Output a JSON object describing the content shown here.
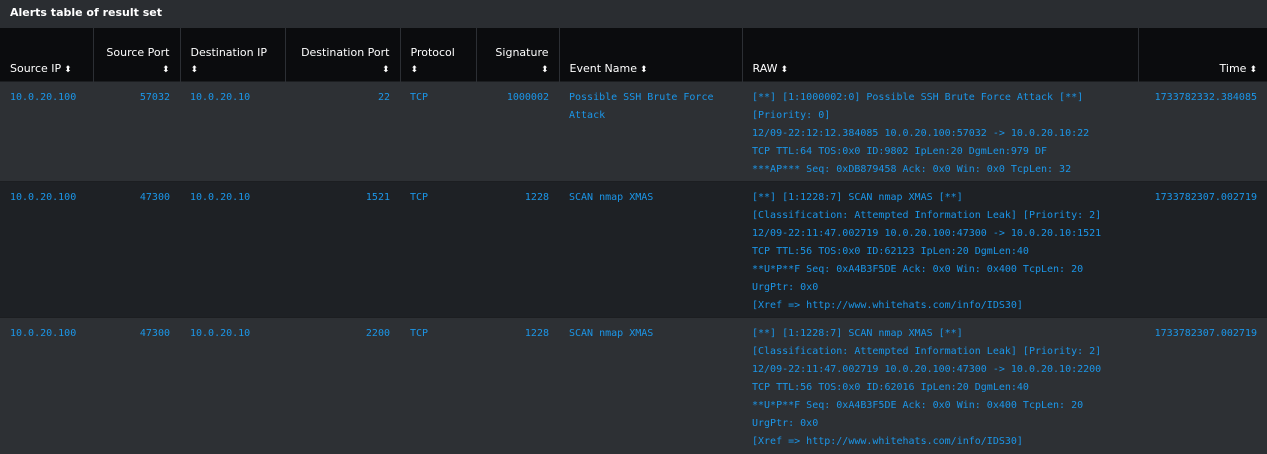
{
  "panel": {
    "title": "Alerts table of result set"
  },
  "colors": {
    "link": "#1b96e8",
    "header_bg": "#0b0c0e",
    "row_odd": "#2d3034",
    "row_even": "#1e2125"
  },
  "columns": [
    {
      "label": "Source IP",
      "sort_icon": "sort-icon"
    },
    {
      "label": "Source Port",
      "sort_icon": "sort-icon"
    },
    {
      "label": "Destination IP",
      "sort_icon": "sort-icon"
    },
    {
      "label": "Destination Port",
      "sort_icon": "sort-icon"
    },
    {
      "label": "Protocol",
      "sort_icon": "sort-icon"
    },
    {
      "label": "Signature",
      "sort_icon": "sort-icon"
    },
    {
      "label": "Event Name",
      "sort_icon": "sort-icon"
    },
    {
      "label": "RAW",
      "sort_icon": "sort-icon"
    },
    {
      "label": "Time",
      "sort_icon": "sort-icon"
    }
  ],
  "rows": [
    {
      "source_ip": "10.0.20.100",
      "source_port": "57032",
      "destination_ip": "10.0.20.10",
      "destination_port": "22",
      "protocol": "TCP",
      "signature": "1000002",
      "event_name": "Possible SSH Brute Force Attack",
      "raw": [
        "[**] [1:1000002:0] Possible SSH Brute Force Attack [**]",
        "[Priority: 0]",
        "12/09-22:12:12.384085 10.0.20.100:57032 -> 10.0.20.10:22",
        "TCP TTL:64 TOS:0x0 ID:9802 IpLen:20 DgmLen:979 DF",
        "***AP*** Seq: 0xDB879458  Ack: 0x0  Win: 0x0  TcpLen: 32"
      ],
      "time": "1733782332.384085"
    },
    {
      "source_ip": "10.0.20.100",
      "source_port": "47300",
      "destination_ip": "10.0.20.10",
      "destination_port": "1521",
      "protocol": "TCP",
      "signature": "1228",
      "event_name": "SCAN nmap XMAS",
      "raw": [
        "[**] [1:1228:7] SCAN nmap XMAS [**]",
        "[Classification: Attempted Information Leak] [Priority: 2]",
        "12/09-22:11:47.002719 10.0.20.100:47300 -> 10.0.20.10:1521",
        "TCP TTL:56 TOS:0x0 ID:62123 IpLen:20 DgmLen:40",
        "**U*P**F Seq: 0xA4B3F5DE  Ack: 0x0  Win: 0x400  TcpLen: 20",
        "UrgPtr: 0x0",
        "[Xref => http://www.whitehats.com/info/IDS30]"
      ],
      "time": "1733782307.002719"
    },
    {
      "source_ip": "10.0.20.100",
      "source_port": "47300",
      "destination_ip": "10.0.20.10",
      "destination_port": "2200",
      "protocol": "TCP",
      "signature": "1228",
      "event_name": "SCAN nmap XMAS",
      "raw": [
        "[**] [1:1228:7] SCAN nmap XMAS [**]",
        "[Classification: Attempted Information Leak] [Priority: 2]",
        "12/09-22:11:47.002719 10.0.20.100:47300 -> 10.0.20.10:2200",
        "TCP TTL:56 TOS:0x0 ID:62016 IpLen:20 DgmLen:40",
        "**U*P**F Seq: 0xA4B3F5DE  Ack: 0x0  Win: 0x400  TcpLen: 20",
        "UrgPtr: 0x0",
        "[Xref => http://www.whitehats.com/info/IDS30]"
      ],
      "time": "1733782307.002719"
    }
  ]
}
